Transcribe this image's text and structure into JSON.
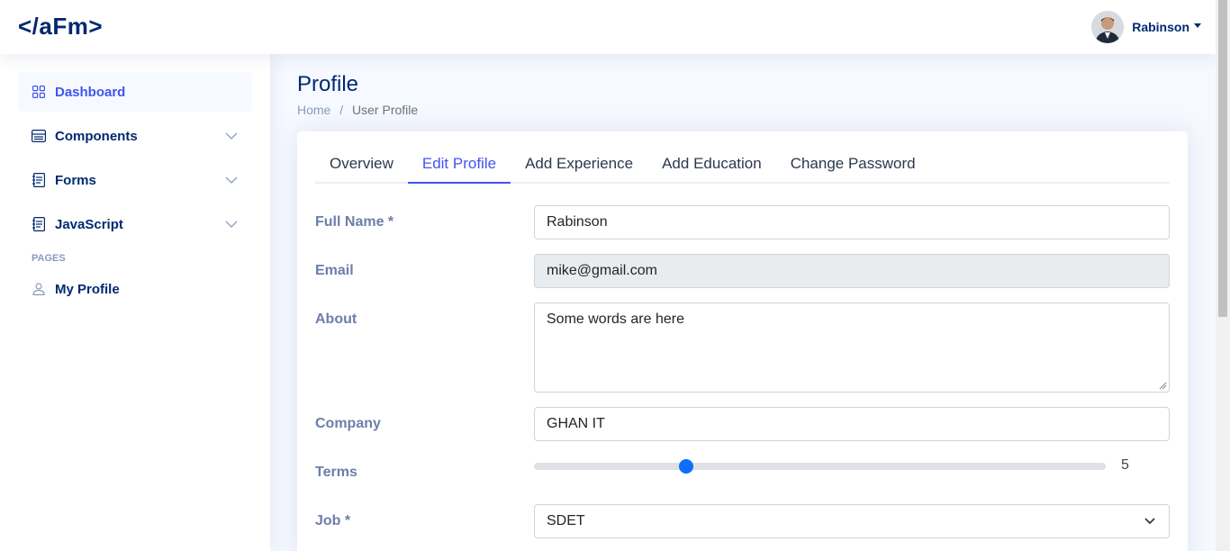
{
  "header": {
    "logo": "</aFm>",
    "user_name": "Rabinson"
  },
  "sidebar": {
    "items": [
      {
        "label": "Dashboard",
        "icon": "grid-icon"
      },
      {
        "label": "Components",
        "icon": "menu-icon"
      },
      {
        "label": "Forms",
        "icon": "journal-icon"
      },
      {
        "label": "JavaScript",
        "icon": "journal-icon"
      }
    ],
    "heading": "PAGES",
    "profile_label": "My Profile"
  },
  "page": {
    "title": "Profile",
    "breadcrumb_home": "Home",
    "breadcrumb_sep": "/",
    "breadcrumb_current": "User Profile"
  },
  "tabs": [
    "Overview",
    "Edit Profile",
    "Add Experience",
    "Add Education",
    "Change Password"
  ],
  "form": {
    "full_name_label": "Full Name *",
    "full_name_value": "Rabinson",
    "email_label": "Email",
    "email_value": "mike@gmail.com",
    "about_label": "About",
    "about_value": "Some words are here",
    "company_label": "Company",
    "company_value": "GHAN IT",
    "terms_label": "Terms",
    "terms_value": "5",
    "terms_fraction": 0.26,
    "job_label": "Job *",
    "job_value": "SDET"
  },
  "colors": {
    "accent": "#4154f1",
    "navy": "#012970",
    "slider": "#0d6efd"
  }
}
